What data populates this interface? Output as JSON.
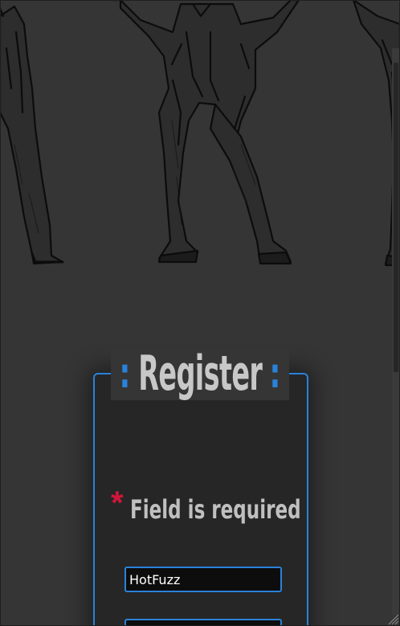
{
  "register": {
    "legend_open": ":",
    "legend_title": "Register",
    "legend_close": ":",
    "required_star": "*",
    "required_text": "Field is required",
    "username_value": "HotFuzz",
    "second_value": ""
  },
  "colors": {
    "background": "#353535",
    "panel": "#262626",
    "accent": "#2a82da",
    "required": "#d0163a",
    "text": "#c0c0c0"
  },
  "icons": {
    "hero": "dancing-figures-illustration",
    "resize": "resize-grip-icon"
  }
}
